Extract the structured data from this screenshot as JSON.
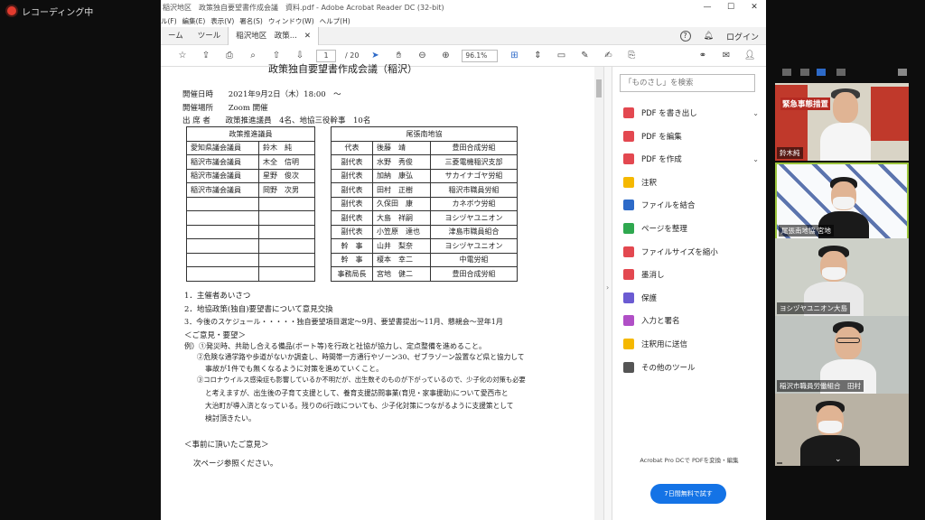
{
  "recording": {
    "label": "レコーディング中"
  },
  "window": {
    "title": "稲沢地区　政策独自要望書作成会議　資料.pdf - Adobe Acrobat Reader DC (32-bit)",
    "controls": [
      "—",
      "☐",
      "✕"
    ]
  },
  "menu": [
    "ル(F)",
    "編集(E)",
    "表示(V)",
    "署名(S)",
    "ウィンドウ(W)",
    "ヘルプ(H)"
  ],
  "tabs": {
    "home": "ーム",
    "tools": "ツール",
    "doc": "稲沢地区　政策...",
    "login": "ログイン"
  },
  "toolbar": {
    "page_current": "1",
    "page_total": "/ 20",
    "zoom": "96.1%"
  },
  "document": {
    "heading_partial": "政策独自要望書作成会議（稲沢）",
    "date_label": "開催日時",
    "date_value": "2021年9月2日（木）18:00　〜",
    "place_label": "開催場所",
    "place_value": "Zoom 開催",
    "attend_label": "出 席 者",
    "attend_value": "政策推進議員　4名、地協三役幹事　10名",
    "left_header": "政策推進議員",
    "right_header": "尾張南地協",
    "rows": [
      [
        "愛知県議会議員",
        "鈴木　純",
        "代表",
        "後藤　靖",
        "豊田合成労組"
      ],
      [
        "稲沢市議会議員",
        "木全　信明",
        "副代表",
        "水野　秀俊",
        "三菱電機稲沢支部"
      ],
      [
        "稲沢市議会議員",
        "星野　俊次",
        "副代表",
        "加納　康弘",
        "サカイナゴヤ労組"
      ],
      [
        "稲沢市議会議員",
        "岡野　次男",
        "副代表",
        "田村　正樹",
        "稲沢市職員労組"
      ],
      [
        "",
        "",
        "副代表",
        "久保田　康",
        "カネボウ労組"
      ],
      [
        "",
        "",
        "副代表",
        "大島　祥嗣",
        "ヨシヅヤユニオン"
      ],
      [
        "",
        "",
        "副代表",
        "小笠原　達也",
        "津島市職員組合"
      ],
      [
        "",
        "",
        "幹　事",
        "山井　梨奈",
        "ヨシヅヤユニオン"
      ],
      [
        "",
        "",
        "幹　事",
        "榎本　幸二",
        "中電労組"
      ],
      [
        "",
        "",
        "事務局長",
        "宮地　健二",
        "豊田合成労組"
      ]
    ],
    "agenda": [
      "1．主催者あいさつ",
      "2．地協政策(独自)要望書について意見交換",
      "3．今後のスケジュール・・・・・独自要望項目選定〜9月、要望書提出〜11月、懇親会〜翌年1月"
    ],
    "opinion_heading": "＜ご意見・要望＞",
    "examples": [
      "例）①発災時、共助し合える備品(ボート等)を行政と社協が協力し、定点整備を進めること。",
      "②危険な通学路や歩道がないか調査し、時間帯一方通行やゾーン30、ゼブラゾーン設置など県と協力して",
      "事故が1件でも無くなるように対策を進めていくこと。",
      "③コロナウイルス感染症も影響しているか不明だが、出生数そのものが下がっているので、少子化の対策も必要",
      "と考えますが、出生後の子育て支援として、養育支援訪問事業(育児・家事援助)について愛西市と",
      "大治町が導入済となっている。残りの6行政についても、少子化対策につながるように支援策として",
      "検討頂きたい。"
    ],
    "prior_heading": "＜事前に頂いたご意見＞",
    "next_page": "次ページ参照ください。"
  },
  "panel": {
    "search_placeholder": "「ものさし」を検索",
    "tools": [
      {
        "label": "PDF を書き出し",
        "color": "#e34850",
        "chev": "⌄"
      },
      {
        "label": "PDF を編集",
        "color": "#e34850",
        "chev": ""
      },
      {
        "label": "PDF を作成",
        "color": "#e34850",
        "chev": "⌄"
      },
      {
        "label": "注釈",
        "color": "#f5b800",
        "chev": ""
      },
      {
        "label": "ファイルを結合",
        "color": "#2d6ac8",
        "chev": ""
      },
      {
        "label": "ページを整理",
        "color": "#2fa84f",
        "chev": ""
      },
      {
        "label": "ファイルサイズを縮小",
        "color": "#e34850",
        "chev": ""
      },
      {
        "label": "墨消し",
        "color": "#e34850",
        "chev": ""
      },
      {
        "label": "保護",
        "color": "#6b5bd2",
        "chev": ""
      },
      {
        "label": "入力と署名",
        "color": "#b04fc6",
        "chev": ""
      },
      {
        "label": "注釈用に送信",
        "color": "#f5b800",
        "chev": ""
      },
      {
        "label": "その他のツール",
        "color": "#555555",
        "chev": ""
      }
    ],
    "promo": "Acrobat Pro DCで PDFを変換・編集",
    "trial_button": "7日間無料で試す"
  },
  "videos": [
    {
      "name": "鈴木純"
    },
    {
      "name": "尾張南地協 宮地"
    },
    {
      "name": "ヨシヅヤユニオン大島"
    },
    {
      "name": "稲沢市職員労働組合　田村"
    },
    {
      "name": ""
    }
  ],
  "video_banner": {
    "headline": "緊急事態措置"
  }
}
